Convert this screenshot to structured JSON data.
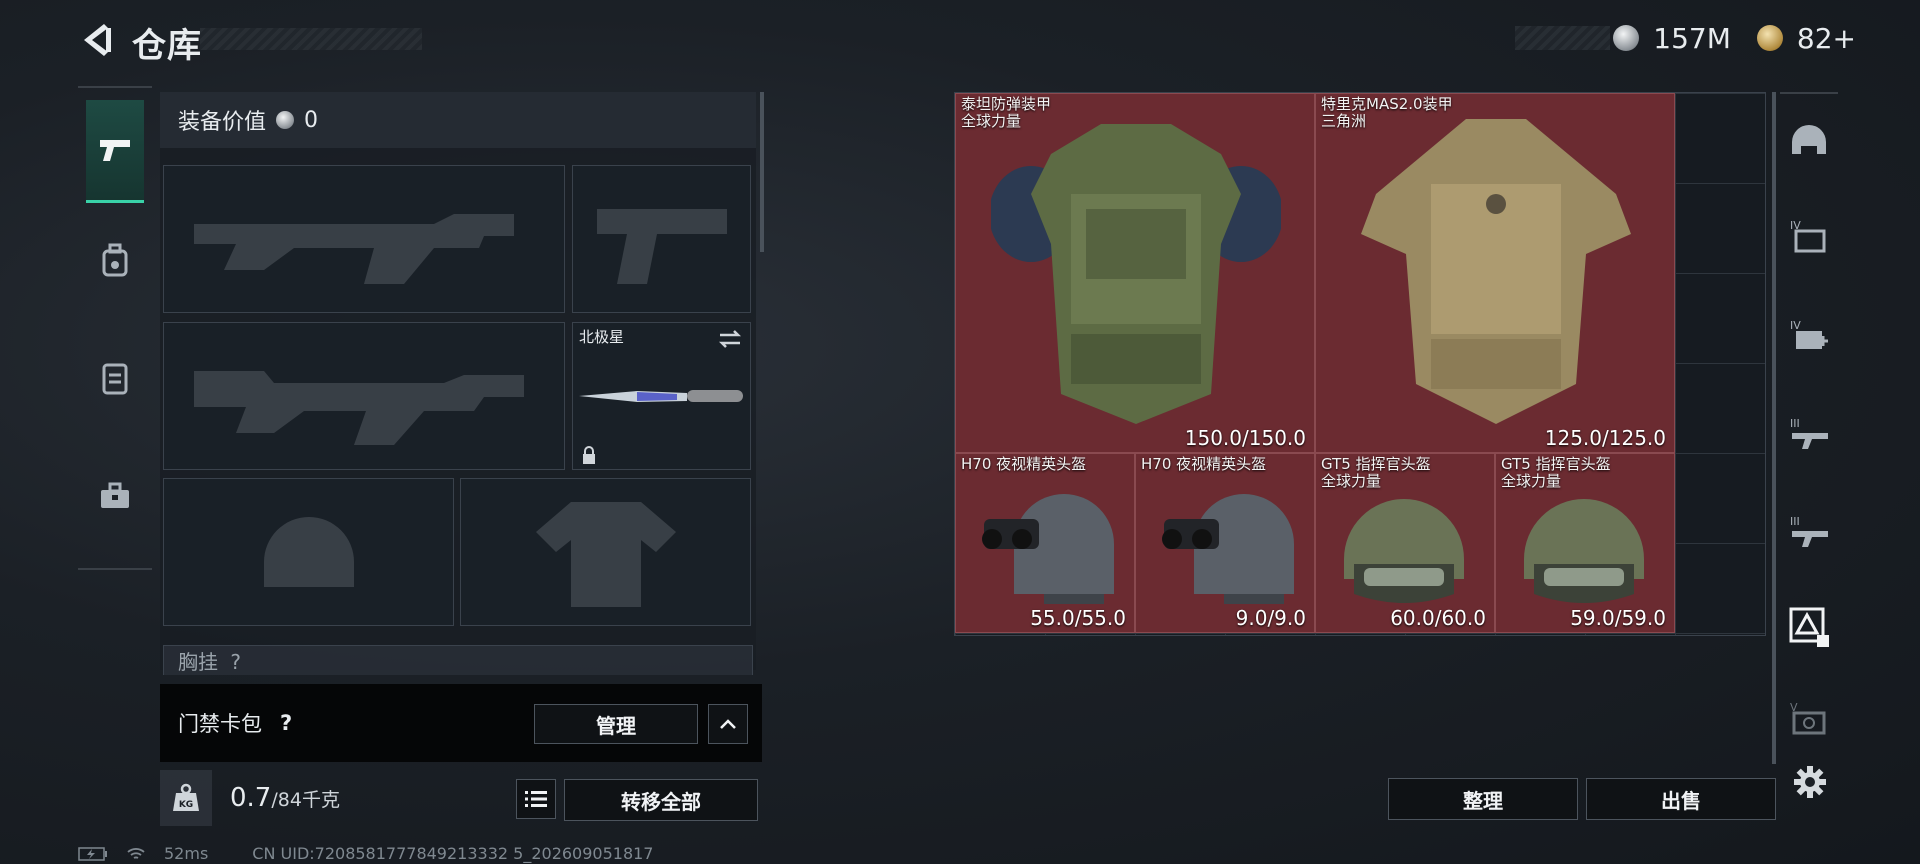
{
  "header": {
    "title": "仓库",
    "currency_1": "157M",
    "currency_2": "82+"
  },
  "left_nav": {
    "items": [
      "weapons-icon",
      "backpack-icon",
      "vest-icon",
      "toolbox-icon"
    ]
  },
  "equipment": {
    "value_label": "装备价值",
    "value_amount": "0",
    "melee_name": "北极星",
    "chest_label": "胸挂",
    "chest_hint": "?"
  },
  "keycard": {
    "label": "门禁卡包",
    "help": "?",
    "manage_label": "管理"
  },
  "capacity": {
    "current": "0.7",
    "max": "/84千克",
    "transfer_label": "转移全部"
  },
  "status": {
    "ping": "52ms",
    "uid": "CN UID:7208581777849213332 5_202609051817"
  },
  "storage": {
    "items": [
      {
        "name": "泰坦防弹装甲",
        "subtitle": "全球力量",
        "durability": "150.0/150.0",
        "type": "armor"
      },
      {
        "name": "特里克MAS2.0装甲",
        "subtitle": "三角洲",
        "durability": "125.0/125.0",
        "type": "armor-camo"
      },
      {
        "name": "H70 夜视精英头盔",
        "subtitle": "",
        "durability": "55.0/55.0",
        "type": "nv-helmet"
      },
      {
        "name": "H70 夜视精英头盔",
        "subtitle": "",
        "durability": "9.0/9.0",
        "type": "nv-helmet"
      },
      {
        "name": "GT5 指挥官头盔",
        "subtitle": "全球力量",
        "durability": "60.0/60.0",
        "type": "cmd-helmet"
      },
      {
        "name": "GT5 指挥官头盔",
        "subtitle": "全球力量",
        "durability": "59.0/59.0",
        "type": "cmd-helmet"
      }
    ],
    "sort_label": "整理",
    "sell_label": "出售"
  },
  "right_nav": {
    "labels": [
      "",
      "IV",
      "IV",
      "III",
      "III",
      "",
      "V",
      ""
    ]
  },
  "colors": {
    "item_bg": "#6b2b31",
    "accent": "#39d2a8"
  }
}
